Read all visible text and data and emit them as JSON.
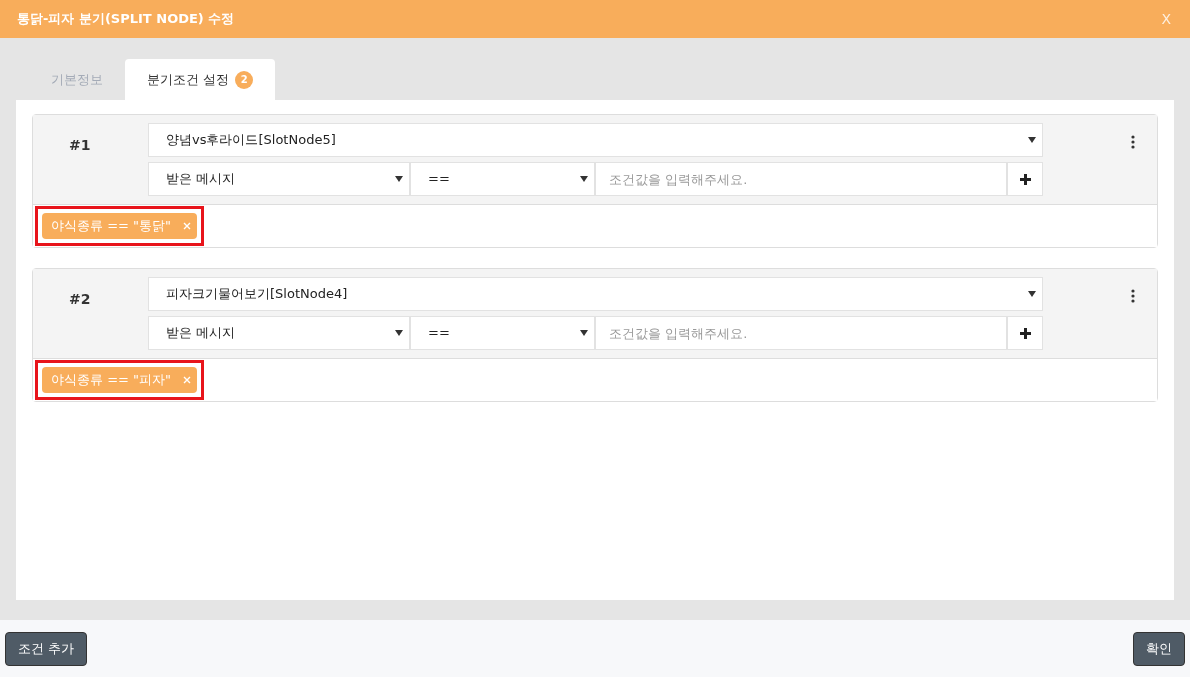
{
  "window": {
    "title": "통닭-피자 분기(SPLIT NODE) 수정",
    "close": "X"
  },
  "tabs": [
    {
      "label": "기본정보",
      "selected": false
    },
    {
      "label": "분기조건 설정",
      "selected": true,
      "badge": "2"
    }
  ],
  "conditions": [
    {
      "number": "#1",
      "slot": "양념vs후라이드[SlotNode5]",
      "source": "받은 메시지",
      "operator": "==",
      "value_placeholder": "조건값을 입력해주세요.",
      "tags": [
        {
          "label": "야식종류 == \"통닭\"",
          "highlighted": true
        }
      ]
    },
    {
      "number": "#2",
      "slot": "피자크기물어보기[SlotNode4]",
      "source": "받은 메시지",
      "operator": "==",
      "value_placeholder": "조건값을 입력해주세요.",
      "tags": [
        {
          "label": "야식종류 == \"피자\"",
          "highlighted": true
        }
      ]
    }
  ],
  "footer": {
    "add_button": "조건 추가",
    "confirm_button": "확인"
  }
}
